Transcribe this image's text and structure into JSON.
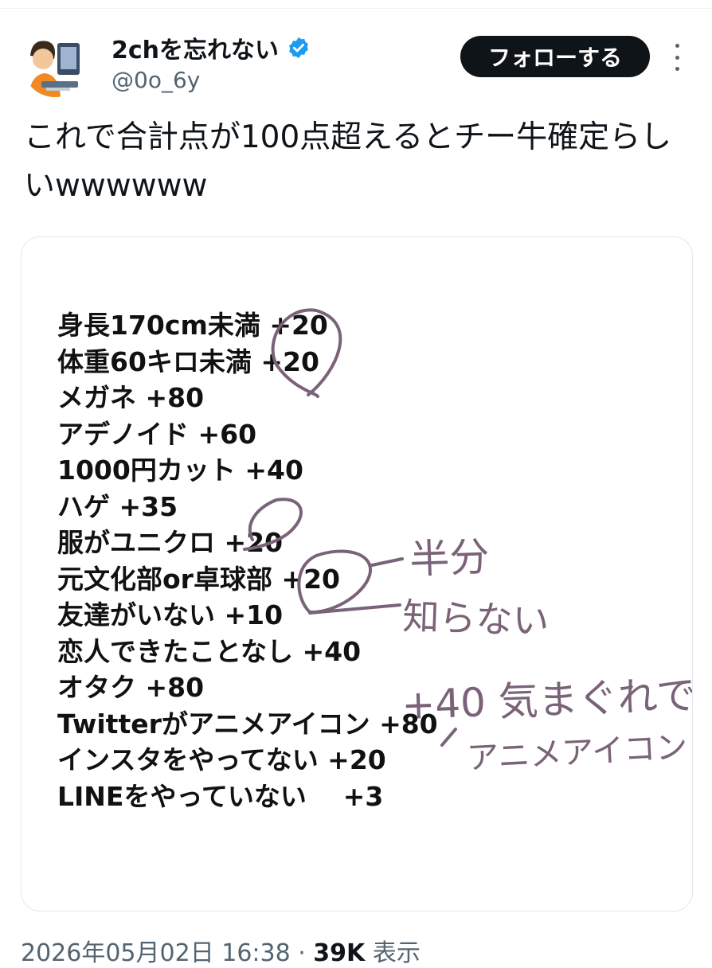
{
  "tweet": {
    "display_name": "2chを忘れない",
    "handle": "@0o_6y",
    "follow_label": "フォローする",
    "text": "これで合計点が100点超えるとチー牛確定らしいwwwwww",
    "icons": {
      "avatar": "avatar-illustration",
      "verified": "verified-badge-icon",
      "more": "more-options-icon"
    },
    "colors": {
      "verified_badge": "#1d9bf0",
      "follow_button_bg": "#0f1419",
      "handwriting": "#7a6378"
    }
  },
  "image": {
    "items": [
      {
        "label": "身長170cm未満 +20"
      },
      {
        "label": "体重60キロ未満 +20"
      },
      {
        "label": "メガネ +80"
      },
      {
        "label": "アデノイド +60"
      },
      {
        "label": "1000円カット +40"
      },
      {
        "label": "ハゲ +35"
      },
      {
        "label": "服がユニクロ +20"
      },
      {
        "label": "元文化部or卓球部 +20"
      },
      {
        "label": "友達がいない +10"
      },
      {
        "label": "恋人できたことなし +40"
      },
      {
        "label": "オタク +80"
      },
      {
        "label": "Twitterがアニメアイコン +80"
      },
      {
        "label": "インスタをやってない +20"
      },
      {
        "label": "LINEをやっていない    +3"
      }
    ],
    "handwritten_notes": [
      "半分",
      "知らない",
      "+40 気まぐれで",
      "アニメアイコン"
    ]
  },
  "meta": {
    "date": "2026年05月02日 16:38",
    "separator": " · ",
    "views_count": "39K",
    "views_label": " 表示"
  }
}
